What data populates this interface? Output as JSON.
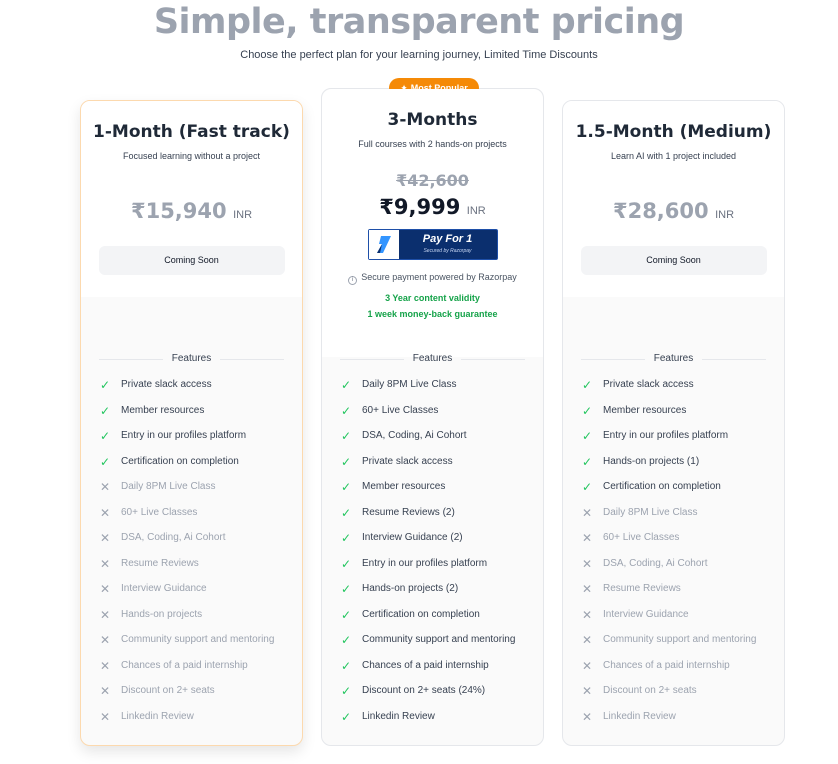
{
  "header": {
    "title": "Simple, transparent pricing",
    "subtitle": "Choose the perfect plan for your learning journey, Limited Time Discounts"
  },
  "colors": {
    "accent": "#f58a07",
    "check": "#22c55e",
    "cross": "#9ca3af",
    "note": "#16a34a",
    "pay": "#0b2f6e"
  },
  "plans": [
    {
      "name": "1-Month (Fast track)",
      "description": "Focused learning without a project",
      "price": "₹15,940",
      "currency": "INR",
      "button": "Coming Soon",
      "features_heading": "Features",
      "features": [
        {
          "text": "Private slack access",
          "included": true
        },
        {
          "text": "Member resources",
          "included": true
        },
        {
          "text": "Entry in our profiles platform",
          "included": true
        },
        {
          "text": "Certification on completion",
          "included": true
        },
        {
          "text": "Daily 8PM Live Class",
          "included": false
        },
        {
          "text": "60+ Live Classes",
          "included": false
        },
        {
          "text": "DSA, Coding, Ai Cohort",
          "included": false
        },
        {
          "text": "Resume Reviews",
          "included": false
        },
        {
          "text": "Interview Guidance",
          "included": false
        },
        {
          "text": "Hands-on projects",
          "included": false
        },
        {
          "text": "Community support and mentoring",
          "included": false
        },
        {
          "text": "Chances of a paid internship",
          "included": false
        },
        {
          "text": "Discount on 2+ seats",
          "included": false
        },
        {
          "text": "Linkedin Review",
          "included": false
        }
      ]
    },
    {
      "badge": "Most Popular",
      "name": "3-Months",
      "description": "Full courses with 2 hands-on projects",
      "old_price": "₹42,600",
      "price": "₹9,999",
      "currency": "INR",
      "pay_button": {
        "label": "Pay For 1",
        "sublabel": "Secured by Razorpay"
      },
      "secure_text": "Secure payment powered by Razorpay",
      "notes": [
        "3 Year content validity",
        "1 week money-back guarantee"
      ],
      "features_heading": "Features",
      "features": [
        {
          "text": "Daily 8PM Live Class",
          "included": true
        },
        {
          "text": "60+ Live Classes",
          "included": true
        },
        {
          "text": "DSA, Coding, Ai Cohort",
          "included": true
        },
        {
          "text": "Private slack access",
          "included": true
        },
        {
          "text": "Member resources",
          "included": true
        },
        {
          "text": "Resume Reviews (2)",
          "included": true
        },
        {
          "text": "Interview Guidance (2)",
          "included": true
        },
        {
          "text": "Entry in our profiles platform",
          "included": true
        },
        {
          "text": "Hands-on projects (2)",
          "included": true
        },
        {
          "text": "Certification on completion",
          "included": true
        },
        {
          "text": "Community support and mentoring",
          "included": true
        },
        {
          "text": "Chances of a paid internship",
          "included": true
        },
        {
          "text": "Discount on 2+ seats (24%)",
          "included": true
        },
        {
          "text": "Linkedin Review",
          "included": true
        }
      ]
    },
    {
      "name": "1.5-Month (Medium)",
      "description": "Learn AI with 1 project included",
      "price": "₹28,600",
      "currency": "INR",
      "button": "Coming Soon",
      "features_heading": "Features",
      "features": [
        {
          "text": "Private slack access",
          "included": true
        },
        {
          "text": "Member resources",
          "included": true
        },
        {
          "text": "Entry in our profiles platform",
          "included": true
        },
        {
          "text": "Hands-on projects (1)",
          "included": true
        },
        {
          "text": "Certification on completion",
          "included": true
        },
        {
          "text": "Daily 8PM Live Class",
          "included": false
        },
        {
          "text": "60+ Live Classes",
          "included": false
        },
        {
          "text": "DSA, Coding, Ai Cohort",
          "included": false
        },
        {
          "text": "Resume Reviews",
          "included": false
        },
        {
          "text": "Interview Guidance",
          "included": false
        },
        {
          "text": "Community support and mentoring",
          "included": false
        },
        {
          "text": "Chances of a paid internship",
          "included": false
        },
        {
          "text": "Discount on 2+ seats",
          "included": false
        },
        {
          "text": "Linkedin Review",
          "included": false
        }
      ]
    }
  ]
}
